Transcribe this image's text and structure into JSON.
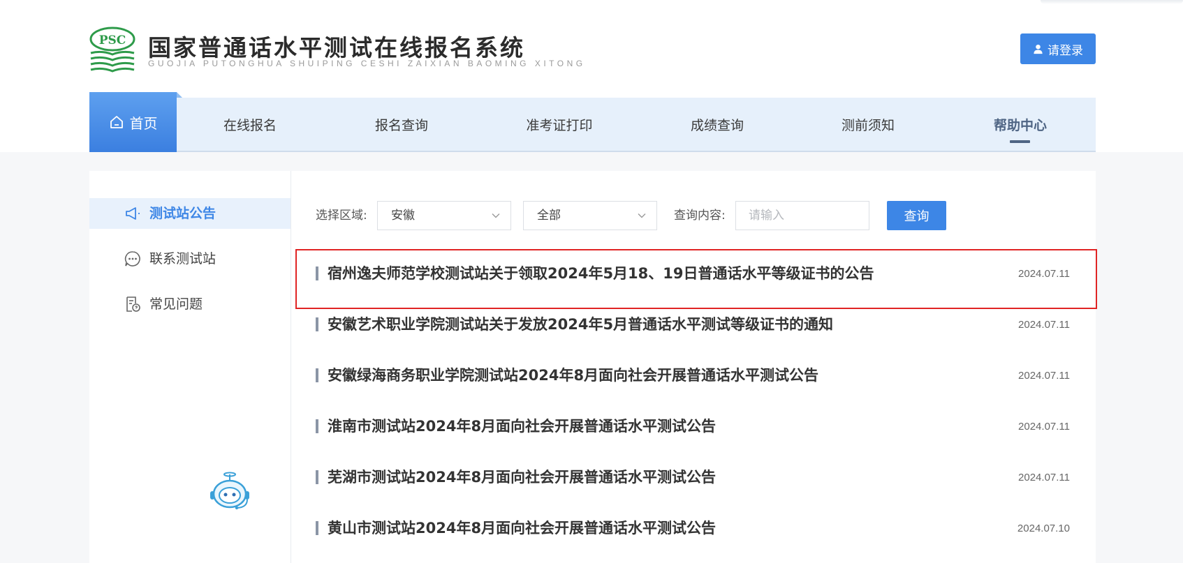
{
  "header": {
    "logo_abbr": "PSC",
    "title": "国家普通话水平测试在线报名系统",
    "subtitle": "GUOJIA PUTONGHUA SHUIPING CESHI ZAIXIAN BAOMING XITONG",
    "login_label": "请登录"
  },
  "nav": {
    "home": "首页",
    "items": [
      "在线报名",
      "报名查询",
      "准考证打印",
      "成绩查询",
      "测前须知",
      "帮助中心"
    ],
    "active": "帮助中心"
  },
  "sidebar": {
    "items": [
      {
        "label": "测试站公告",
        "icon": "megaphone-icon",
        "active": true
      },
      {
        "label": "联系测试站",
        "icon": "chat-bubble-icon",
        "active": false
      },
      {
        "label": "常见问题",
        "icon": "faq-document-icon",
        "active": false
      }
    ]
  },
  "filters": {
    "region_label": "选择区域:",
    "region_value": "安徽",
    "scope_value": "全部",
    "query_label": "查询内容:",
    "query_placeholder": "请输入",
    "query_button": "查询"
  },
  "announcements": [
    {
      "title": "宿州逸夫师范学校测试站关于领取2024年5月18、19日普通话水平等级证书的公告",
      "date": "2024.07.11",
      "highlighted": true
    },
    {
      "title": "安徽艺术职业学院测试站关于发放2024年5月普通话水平测试等级证书的通知",
      "date": "2024.07.11",
      "highlighted": false
    },
    {
      "title": "安徽绿海商务职业学院测试站2024年8月面向社会开展普通话水平测试公告",
      "date": "2024.07.11",
      "highlighted": false
    },
    {
      "title": "淮南市测试站2024年8月面向社会开展普通话水平测试公告",
      "date": "2024.07.11",
      "highlighted": false
    },
    {
      "title": "芜湖市测试站2024年8月面向社会开展普通话水平测试公告",
      "date": "2024.07.11",
      "highlighted": false
    },
    {
      "title": "黄山市测试站2024年8月面向社会开展普通话水平测试公告",
      "date": "2024.07.10",
      "highlighted": false
    }
  ],
  "colors": {
    "accent": "#3d86e6",
    "nav_bg": "#e6f0fb",
    "logo_green": "#2e9b4a",
    "highlight_border": "#e02424"
  }
}
